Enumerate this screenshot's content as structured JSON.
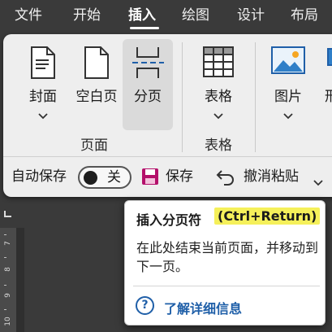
{
  "menu": {
    "tabs": [
      {
        "label": "文件"
      },
      {
        "label": "开始"
      },
      {
        "label": "插入",
        "active": true
      },
      {
        "label": "绘图"
      },
      {
        "label": "设计"
      },
      {
        "label": "布局"
      }
    ]
  },
  "ribbon": {
    "buttons": [
      {
        "label": "封面",
        "icon": "cover-page-icon",
        "has_menu": true
      },
      {
        "label": "空白页",
        "icon": "blank-page-icon",
        "has_menu": false
      },
      {
        "label": "分页",
        "icon": "page-break-icon",
        "has_menu": false,
        "selected": true
      },
      {
        "label": "表格",
        "icon": "table-icon",
        "has_menu": true
      },
      {
        "label": "图片",
        "icon": "picture-icon",
        "has_menu": true
      },
      {
        "label": "形",
        "icon": "shapes-icon",
        "has_menu": false
      }
    ],
    "groups": [
      {
        "label": "页面"
      },
      {
        "label": "表格"
      }
    ]
  },
  "quick_access": {
    "autosave_label": "自动保存",
    "autosave_state": "关",
    "save_label": "保存",
    "undo_label": "撤消粘贴"
  },
  "ruler": {
    "numbers": [
      "7",
      "8",
      "9",
      "10"
    ]
  },
  "tooltip": {
    "title": "插入分页符",
    "shortcut": "(Ctrl+Return)",
    "description": "在此处结束当前页面，并移动到下一页。",
    "help_link": "了解详细信息",
    "help_icon": "?"
  },
  "colors": {
    "background": "#3a3a3a",
    "ribbon": "#eeeeee",
    "save_icon": "#b4106b",
    "link": "#1f5fa8",
    "shortcut_highlight": "#f5f05a"
  }
}
